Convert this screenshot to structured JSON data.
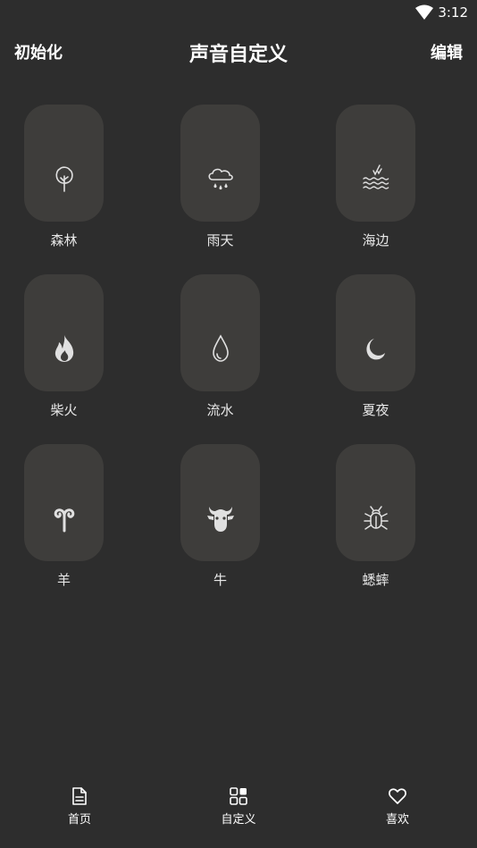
{
  "status": {
    "time": "3:12"
  },
  "header": {
    "left_label": "初始化",
    "title": "声音自定义",
    "right_label": "编辑"
  },
  "sounds": [
    {
      "label": "森林",
      "icon": "tree-icon"
    },
    {
      "label": "雨天",
      "icon": "rain-cloud-icon"
    },
    {
      "label": "海边",
      "icon": "waves-icon"
    },
    {
      "label": "柴火",
      "icon": "fire-icon"
    },
    {
      "label": "流水",
      "icon": "water-drop-icon"
    },
    {
      "label": "夏夜",
      "icon": "moon-icon"
    },
    {
      "label": "羊",
      "icon": "ram-icon"
    },
    {
      "label": "牛",
      "icon": "ox-icon"
    },
    {
      "label": "蟋蟀",
      "icon": "bug-icon"
    }
  ],
  "nav": [
    {
      "label": "首页",
      "icon": "document-icon"
    },
    {
      "label": "自定义",
      "icon": "grid-icon"
    },
    {
      "label": "喜欢",
      "icon": "heart-icon"
    }
  ]
}
